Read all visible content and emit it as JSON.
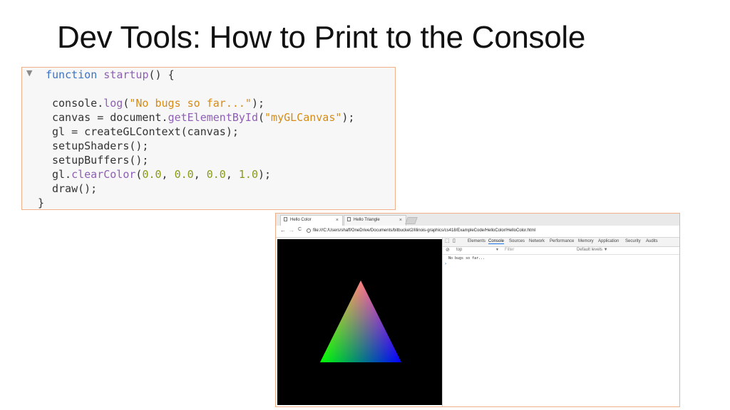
{
  "slide": {
    "title": "Dev Tools: How to Print to the Console"
  },
  "code": {
    "fold_marker": "▼",
    "lines": {
      "l1": [
        "function",
        " ",
        "startup",
        "() {"
      ],
      "l3": [
        "console.",
        "log",
        "(",
        "\"No bugs so far...\"",
        ");"
      ],
      "l4": [
        "canvas = document.",
        "getElementById",
        "(",
        "\"myGLCanvas\"",
        ");"
      ],
      "l5": "gl = createGLContext(canvas);",
      "l6": "setupShaders();",
      "l7": "setupBuffers();",
      "l8": [
        "gl.",
        "clearColor",
        "(",
        "0.0",
        ", ",
        "0.0",
        ", ",
        "0.0",
        ", ",
        "1.0",
        ");"
      ],
      "l9": "draw();",
      "l10": "}"
    }
  },
  "browser": {
    "tabs": [
      {
        "label": "Hello Color",
        "close": "×"
      },
      {
        "label": "Hello Triangle",
        "close": "×"
      }
    ],
    "nav": {
      "back": "←",
      "forward": "→",
      "reload": "C"
    },
    "url": "file:///C:/Users/shaff/OneDrive/Documents/bitbucket2/illinois-graphics/cs418/ExampleCode/HelloColor/HelloColor.html",
    "devtools": {
      "tabs": [
        "Elements",
        "Console",
        "Sources",
        "Network",
        "Performance",
        "Memory",
        "Application",
        "Security",
        "Audits"
      ],
      "context": "top",
      "context_arrow": "▼",
      "filter_placeholder": "Filter",
      "levels": "Default levels ▼",
      "clear_icon": "⊘",
      "console_output": "No bugs so far...",
      "prompt": "›"
    },
    "triangle_colors": {
      "top": "#ff0000",
      "left": "#00ff00",
      "right": "#0000ff"
    }
  }
}
